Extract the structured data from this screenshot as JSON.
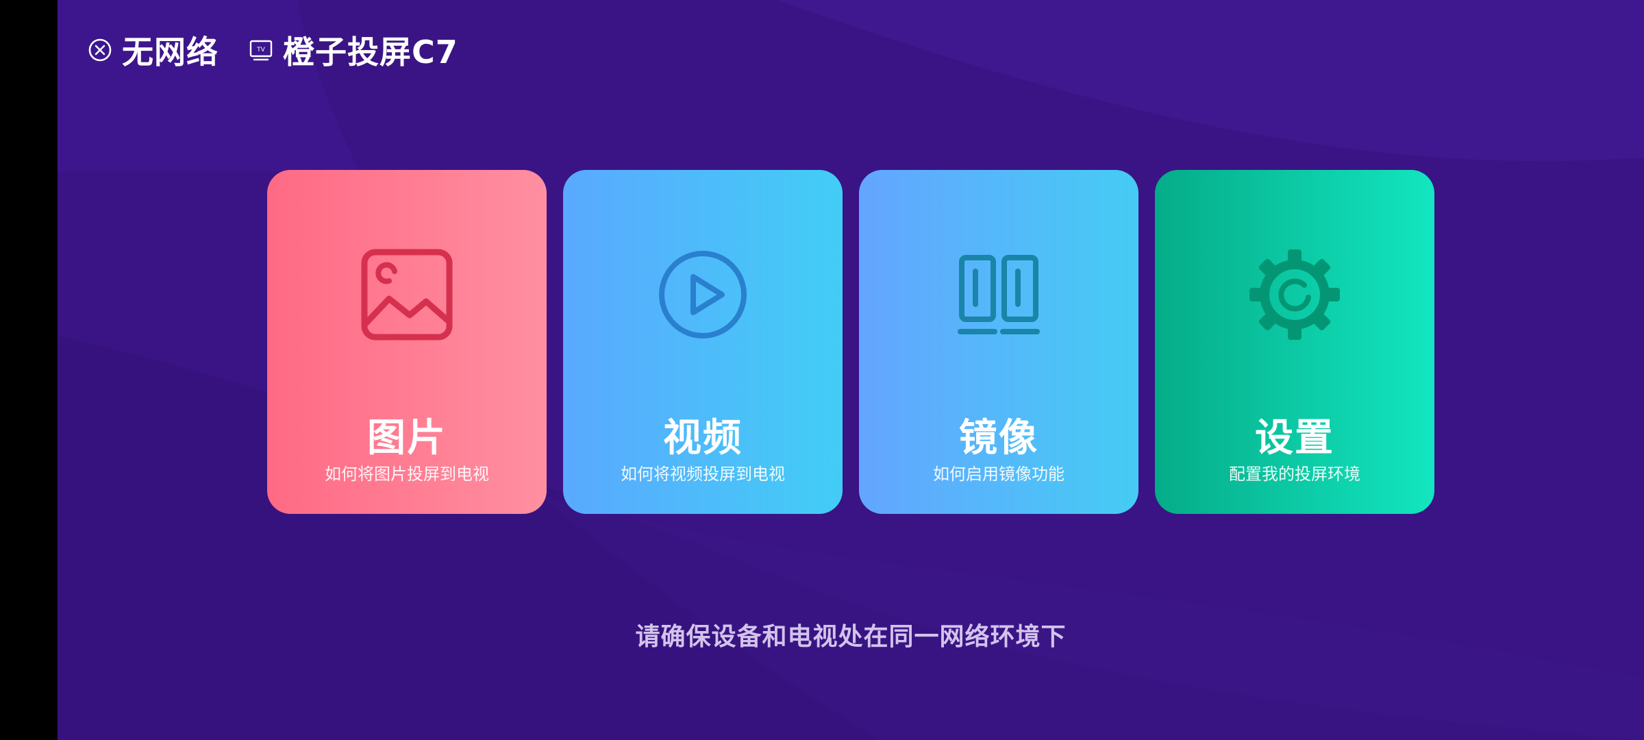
{
  "status": {
    "network_label": "无网络",
    "device_name": "橙子投屏C7",
    "tv_icon_text": "TV"
  },
  "cards": [
    {
      "title": "图片",
      "subtitle": "如何将图片投屏到电视",
      "icon": "image-icon",
      "color": "#ff6a84"
    },
    {
      "title": "视频",
      "subtitle": "如何将视频投屏到电视",
      "icon": "play-circle-icon",
      "color": "#5aa9ff"
    },
    {
      "title": "镜像",
      "subtitle": "如何启用镜像功能",
      "icon": "mirror-icon",
      "color": "#64a5ff"
    },
    {
      "title": "设置",
      "subtitle": "配置我的投屏环境",
      "icon": "gear-icon",
      "color": "#05ac88"
    }
  ],
  "hint": "请确保设备和电视处在同一网络环境下",
  "colors": {
    "background": "#3a1484",
    "image_icon_stroke": "#d6304f",
    "play_icon_stroke": "#2a7fce",
    "mirror_icon_stroke": "#1a85a8",
    "gear_icon_stroke": "#049674"
  }
}
